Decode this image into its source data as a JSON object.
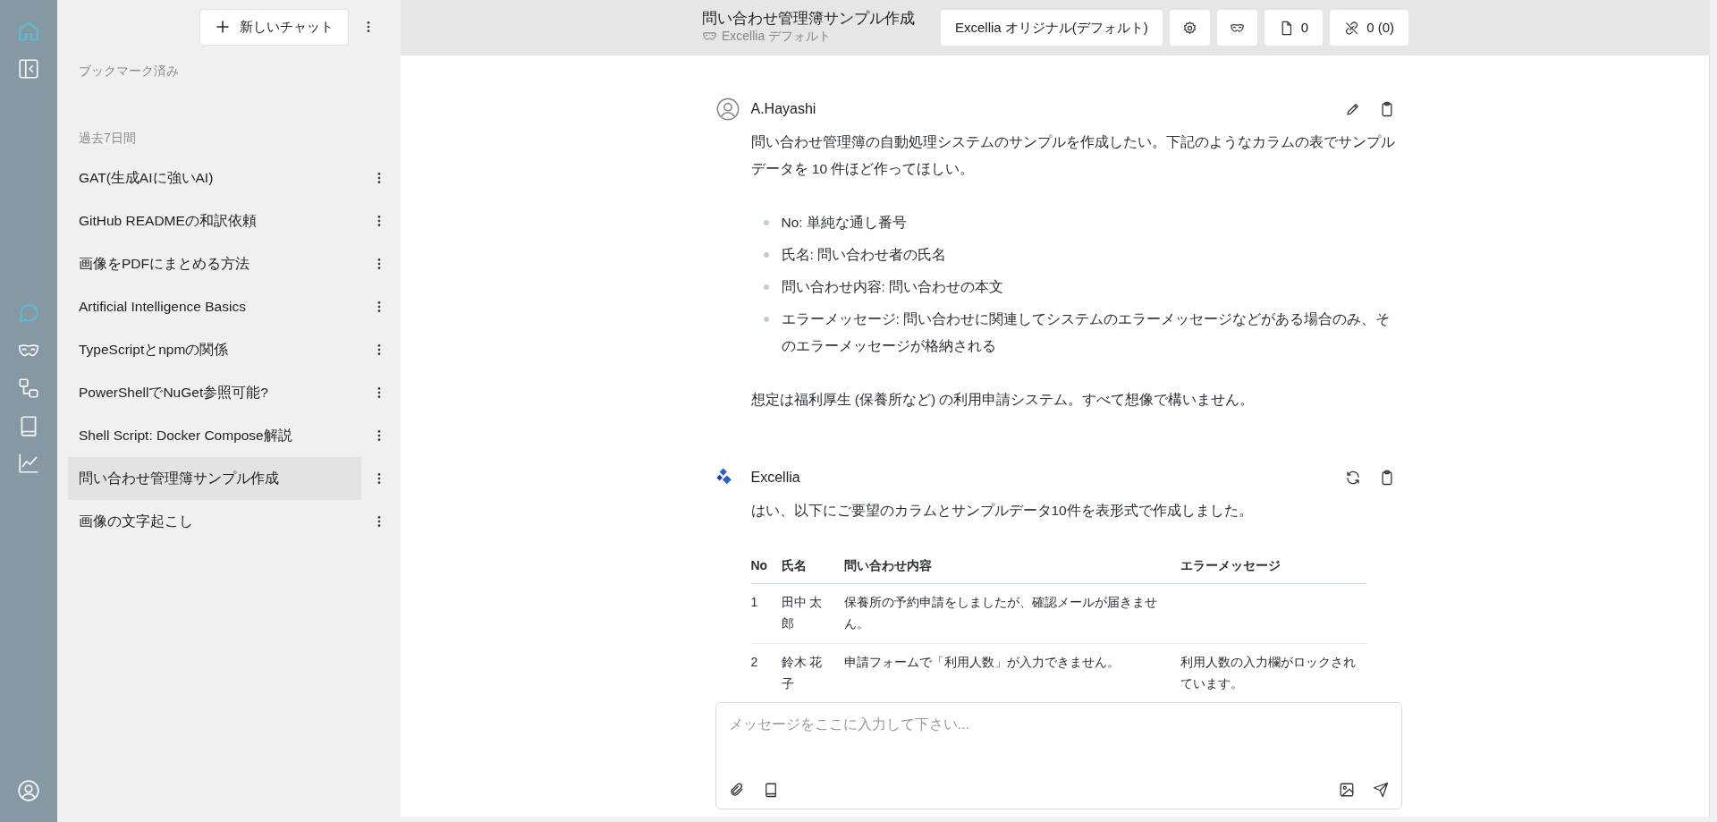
{
  "rail": {
    "items": [
      {
        "active": true
      },
      {
        "active": false
      },
      {
        "active": true
      },
      {
        "active": false
      },
      {
        "active": false
      },
      {
        "active": false
      },
      {
        "active": false
      },
      {
        "active": false
      }
    ]
  },
  "sidebar": {
    "new_chat_button": "新しいチャット",
    "bookmarked_heading": "ブックマーク済み",
    "recent_heading": "過去7日間",
    "items": [
      {
        "label": "GAT(生成AIに強いAI)",
        "selected": false
      },
      {
        "label": "GitHub READMEの和訳依頼",
        "selected": false
      },
      {
        "label": "画像をPDFにまとめる方法",
        "selected": false
      },
      {
        "label": "Artificial Intelligence Basics",
        "selected": false
      },
      {
        "label": "TypeScriptとnpmの関係",
        "selected": false
      },
      {
        "label": "PowerShellでNuGet参照可能?",
        "selected": false
      },
      {
        "label": "Shell Script: Docker Compose解説",
        "selected": false
      },
      {
        "label": "問い合わせ管理簿サンプル作成",
        "selected": true
      },
      {
        "label": "画像の文字起こし",
        "selected": false
      }
    ]
  },
  "header": {
    "title": "問い合わせ管理簿サンプル作成",
    "subtitle": "Excellia デフォルト",
    "model_button": "Excellia オリジナル(デフォルト)",
    "files_count": "0",
    "links_count": "0 (0)"
  },
  "messages": [
    {
      "kind": "user",
      "author": "A.Hayashi",
      "blocks": [
        {
          "kind": "paragraph",
          "text": "問い合わせ管理簿の自動処理システムのサンプルを作成したい。下記のようなカラムの表でサンプルデータを 10 件ほど作ってほしい。"
        },
        {
          "kind": "list",
          "items": [
            "No: 単純な通し番号",
            "氏名: 問い合わせ者の氏名",
            "問い合わせ内容: 問い合わせの本文",
            "エラーメッセージ: 問い合わせに関連してシステムのエラーメッセージなどがある場合のみ、そのエラーメッセージが格納される"
          ]
        },
        {
          "kind": "paragraph",
          "text": "想定は福利厚生 (保養所など) の利用申請システム。すべて想像で構いません。"
        }
      ]
    },
    {
      "kind": "assistant",
      "author": "Excellia",
      "blocks": [
        {
          "kind": "paragraph",
          "text": "はい、以下にご要望のカラムとサンプルデータ10件を表形式で作成しました。"
        },
        {
          "kind": "table",
          "columns": [
            "No",
            "氏名",
            "問い合わせ内容",
            "エラーメッセージ"
          ],
          "rows": [
            [
              "1",
              "田中 太郎",
              "保養所の予約申請をしましたが、確認メールが届きません。",
              null
            ],
            [
              "2",
              "鈴木 花子",
              "申請フォームで「利用人数」が入力できません。",
              "利用人数の入力欄がロックされています。"
            ]
          ]
        }
      ]
    }
  ],
  "composer": {
    "placeholder": "メッセージをここに入力して下さい..."
  }
}
